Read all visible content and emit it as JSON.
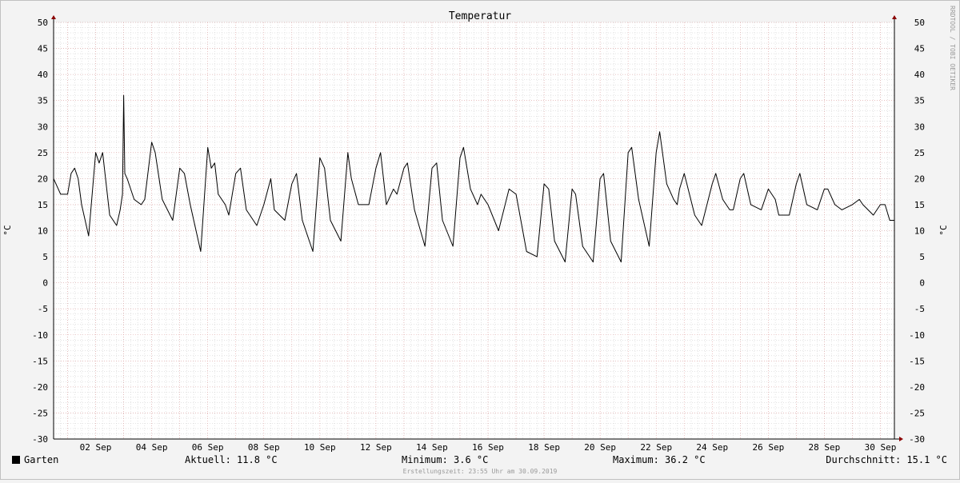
{
  "chart_data": {
    "type": "line",
    "title": "Temperatur",
    "ylabel": "°C",
    "ylim": [
      -30,
      50
    ],
    "yticks": [
      50,
      45,
      40,
      35,
      30,
      25,
      20,
      15,
      10,
      5,
      0,
      -5,
      -10,
      -15,
      -20,
      -25,
      -30
    ],
    "xlim": [
      "2019-09-01 00:00",
      "2019-10-01 00:00"
    ],
    "xticks": [
      {
        "date": "2019-09-02 12:00",
        "label": "02 Sep"
      },
      {
        "date": "2019-09-04 12:00",
        "label": "04 Sep"
      },
      {
        "date": "2019-09-06 12:00",
        "label": "06 Sep"
      },
      {
        "date": "2019-09-08 12:00",
        "label": "08 Sep"
      },
      {
        "date": "2019-09-10 12:00",
        "label": "10 Sep"
      },
      {
        "date": "2019-09-12 12:00",
        "label": "12 Sep"
      },
      {
        "date": "2019-09-14 12:00",
        "label": "14 Sep"
      },
      {
        "date": "2019-09-16 12:00",
        "label": "16 Sep"
      },
      {
        "date": "2019-09-18 12:00",
        "label": "18 Sep"
      },
      {
        "date": "2019-09-20 12:00",
        "label": "20 Sep"
      },
      {
        "date": "2019-09-22 12:00",
        "label": "22 Sep"
      },
      {
        "date": "2019-09-24 12:00",
        "label": "24 Sep"
      },
      {
        "date": "2019-09-26 12:00",
        "label": "26 Sep"
      },
      {
        "date": "2019-09-28 12:00",
        "label": "28 Sep"
      },
      {
        "date": "2019-09-30 12:00",
        "label": "30 Sep"
      }
    ],
    "grid": true,
    "series": [
      {
        "name": "Garten",
        "color": "#000000",
        "points": [
          [
            "2019-09-01 00:00",
            20
          ],
          [
            "2019-09-01 06:00",
            17
          ],
          [
            "2019-09-01 12:00",
            17
          ],
          [
            "2019-09-01 15:00",
            21
          ],
          [
            "2019-09-01 18:00",
            22
          ],
          [
            "2019-09-01 21:00",
            20
          ],
          [
            "2019-09-02 00:00",
            15
          ],
          [
            "2019-09-02 06:00",
            9
          ],
          [
            "2019-09-02 12:00",
            25
          ],
          [
            "2019-09-02 15:00",
            23
          ],
          [
            "2019-09-02 18:00",
            25
          ],
          [
            "2019-09-02 21:00",
            19
          ],
          [
            "2019-09-03 00:00",
            13
          ],
          [
            "2019-09-03 06:00",
            11
          ],
          [
            "2019-09-03 09:00",
            14
          ],
          [
            "2019-09-03 11:00",
            17
          ],
          [
            "2019-09-03 12:00",
            36
          ],
          [
            "2019-09-03 13:00",
            21
          ],
          [
            "2019-09-03 15:00",
            20
          ],
          [
            "2019-09-03 21:00",
            16
          ],
          [
            "2019-09-04 03:00",
            15
          ],
          [
            "2019-09-04 06:00",
            16
          ],
          [
            "2019-09-04 12:00",
            27
          ],
          [
            "2019-09-04 15:00",
            25
          ],
          [
            "2019-09-04 21:00",
            16
          ],
          [
            "2019-09-05 06:00",
            12
          ],
          [
            "2019-09-05 12:00",
            22
          ],
          [
            "2019-09-05 16:00",
            21
          ],
          [
            "2019-09-05 21:00",
            15
          ],
          [
            "2019-09-06 06:00",
            6
          ],
          [
            "2019-09-06 12:00",
            26
          ],
          [
            "2019-09-06 15:00",
            22
          ],
          [
            "2019-09-06 18:00",
            23
          ],
          [
            "2019-09-06 21:00",
            17
          ],
          [
            "2019-09-07 03:00",
            15
          ],
          [
            "2019-09-07 06:00",
            13
          ],
          [
            "2019-09-07 12:00",
            21
          ],
          [
            "2019-09-07 16:00",
            22
          ],
          [
            "2019-09-07 21:00",
            14
          ],
          [
            "2019-09-08 06:00",
            11
          ],
          [
            "2019-09-08 12:00",
            15
          ],
          [
            "2019-09-08 18:00",
            20
          ],
          [
            "2019-09-08 21:00",
            14
          ],
          [
            "2019-09-09 06:00",
            12
          ],
          [
            "2019-09-09 12:00",
            19
          ],
          [
            "2019-09-09 16:00",
            21
          ],
          [
            "2019-09-09 21:00",
            12
          ],
          [
            "2019-09-10 06:00",
            6
          ],
          [
            "2019-09-10 12:00",
            24
          ],
          [
            "2019-09-10 16:00",
            22
          ],
          [
            "2019-09-10 21:00",
            12
          ],
          [
            "2019-09-11 06:00",
            8
          ],
          [
            "2019-09-11 12:00",
            25
          ],
          [
            "2019-09-11 15:00",
            20
          ],
          [
            "2019-09-11 21:00",
            15
          ],
          [
            "2019-09-12 06:00",
            15
          ],
          [
            "2019-09-12 12:00",
            22
          ],
          [
            "2019-09-12 16:00",
            25
          ],
          [
            "2019-09-12 21:00",
            15
          ],
          [
            "2019-09-13 03:00",
            18
          ],
          [
            "2019-09-13 06:00",
            17
          ],
          [
            "2019-09-13 12:00",
            22
          ],
          [
            "2019-09-13 15:00",
            23
          ],
          [
            "2019-09-13 21:00",
            14
          ],
          [
            "2019-09-14 06:00",
            7
          ],
          [
            "2019-09-14 12:00",
            22
          ],
          [
            "2019-09-14 16:00",
            23
          ],
          [
            "2019-09-14 21:00",
            12
          ],
          [
            "2019-09-15 06:00",
            7
          ],
          [
            "2019-09-15 12:00",
            24
          ],
          [
            "2019-09-15 15:00",
            26
          ],
          [
            "2019-09-15 21:00",
            18
          ],
          [
            "2019-09-16 03:00",
            15
          ],
          [
            "2019-09-16 06:00",
            17
          ],
          [
            "2019-09-16 12:00",
            15
          ],
          [
            "2019-09-16 21:00",
            10
          ],
          [
            "2019-09-17 06:00",
            18
          ],
          [
            "2019-09-17 12:00",
            17
          ],
          [
            "2019-09-17 21:00",
            6
          ],
          [
            "2019-09-18 06:00",
            5
          ],
          [
            "2019-09-18 12:00",
            19
          ],
          [
            "2019-09-18 16:00",
            18
          ],
          [
            "2019-09-18 21:00",
            8
          ],
          [
            "2019-09-19 06:00",
            4
          ],
          [
            "2019-09-19 12:00",
            18
          ],
          [
            "2019-09-19 15:00",
            17
          ],
          [
            "2019-09-19 21:00",
            7
          ],
          [
            "2019-09-20 06:00",
            4
          ],
          [
            "2019-09-20 12:00",
            20
          ],
          [
            "2019-09-20 15:00",
            21
          ],
          [
            "2019-09-20 21:00",
            8
          ],
          [
            "2019-09-21 06:00",
            4
          ],
          [
            "2019-09-21 12:00",
            25
          ],
          [
            "2019-09-21 15:00",
            26
          ],
          [
            "2019-09-21 21:00",
            16
          ],
          [
            "2019-09-22 06:00",
            7
          ],
          [
            "2019-09-22 12:00",
            25
          ],
          [
            "2019-09-22 15:00",
            29
          ],
          [
            "2019-09-22 21:00",
            19
          ],
          [
            "2019-09-23 03:00",
            16
          ],
          [
            "2019-09-23 06:00",
            15
          ],
          [
            "2019-09-23 08:00",
            18
          ],
          [
            "2019-09-23 12:00",
            21
          ],
          [
            "2019-09-23 21:00",
            13
          ],
          [
            "2019-09-24 03:00",
            11
          ],
          [
            "2019-09-24 12:00",
            19
          ],
          [
            "2019-09-24 15:00",
            21
          ],
          [
            "2019-09-24 21:00",
            16
          ],
          [
            "2019-09-25 03:00",
            14
          ],
          [
            "2019-09-25 06:00",
            14
          ],
          [
            "2019-09-25 12:00",
            20
          ],
          [
            "2019-09-25 15:00",
            21
          ],
          [
            "2019-09-25 21:00",
            15
          ],
          [
            "2019-09-26 06:00",
            14
          ],
          [
            "2019-09-26 12:00",
            18
          ],
          [
            "2019-09-26 18:00",
            16
          ],
          [
            "2019-09-26 21:00",
            13
          ],
          [
            "2019-09-27 06:00",
            13
          ],
          [
            "2019-09-27 12:00",
            19
          ],
          [
            "2019-09-27 15:00",
            21
          ],
          [
            "2019-09-27 21:00",
            15
          ],
          [
            "2019-09-28 06:00",
            14
          ],
          [
            "2019-09-28 12:00",
            18
          ],
          [
            "2019-09-28 15:00",
            18
          ],
          [
            "2019-09-28 21:00",
            15
          ],
          [
            "2019-09-29 03:00",
            14
          ],
          [
            "2019-09-29 12:00",
            15
          ],
          [
            "2019-09-29 18:00",
            16
          ],
          [
            "2019-09-29 21:00",
            15
          ],
          [
            "2019-09-30 06:00",
            13
          ],
          [
            "2019-09-30 12:00",
            15
          ],
          [
            "2019-09-30 16:00",
            15
          ],
          [
            "2019-09-30 20:00",
            12
          ],
          [
            "2019-09-30 23:55",
            12
          ]
        ]
      }
    ]
  },
  "legend": {
    "label": "Garten",
    "swatch_color": "#000000",
    "stats": {
      "current": "Aktuell: 11.8 °C",
      "minimum": "Minimum: 3.6 °C",
      "maximum": "Maximum: 36.2 °C",
      "average": "Durchschnitt: 15.1 °C"
    }
  },
  "footer_text": "Erstellungszeit: 23:55 Uhr am 30.09.2019",
  "watermark_text": "RRDTOOL / TOBI OETIKER",
  "colors": {
    "background": "#f3f3f3",
    "plot_background": "#ffffff",
    "major_grid": "#e0a0a0",
    "minor_grid": "#c8c8c8",
    "axis": "#000000",
    "arrow": "#8b0000"
  }
}
